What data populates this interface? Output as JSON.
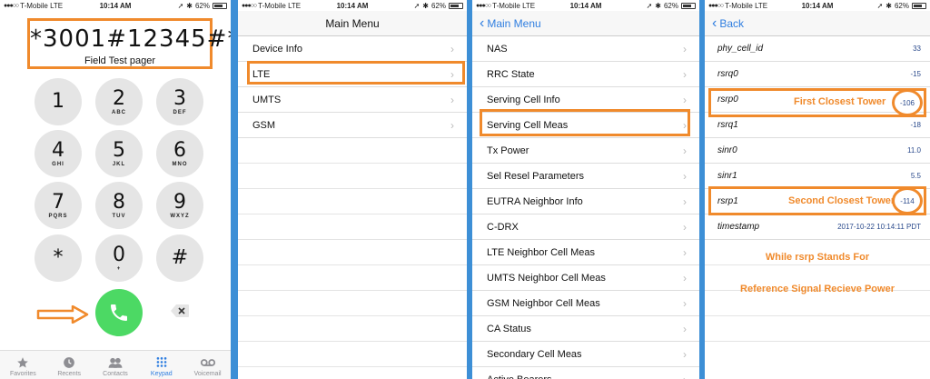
{
  "status": {
    "carrier": "T-Mobile",
    "network": "LTE",
    "time": "10:14 AM",
    "battery": "62%",
    "battery_level": 0.62
  },
  "keypad": {
    "dial_number": "*3001#12345#*",
    "dial_subtitle": "Field Test pager",
    "keys": [
      {
        "digit": "1",
        "letters": ""
      },
      {
        "digit": "2",
        "letters": "ABC"
      },
      {
        "digit": "3",
        "letters": "DEF"
      },
      {
        "digit": "4",
        "letters": "GHI"
      },
      {
        "digit": "5",
        "letters": "JKL"
      },
      {
        "digit": "6",
        "letters": "MNO"
      },
      {
        "digit": "7",
        "letters": "PQRS"
      },
      {
        "digit": "8",
        "letters": "TUV"
      },
      {
        "digit": "9",
        "letters": "WXYZ"
      },
      {
        "digit": "*",
        "letters": ""
      },
      {
        "digit": "0",
        "letters": "+"
      },
      {
        "digit": "#",
        "letters": ""
      }
    ],
    "tabs": [
      {
        "label": "Favorites",
        "icon": "star-icon"
      },
      {
        "label": "Recents",
        "icon": "clock-icon"
      },
      {
        "label": "Contacts",
        "icon": "contacts-icon"
      },
      {
        "label": "Keypad",
        "icon": "keypad-icon",
        "active": true
      },
      {
        "label": "Voicemail",
        "icon": "voicemail-icon"
      }
    ]
  },
  "main_menu": {
    "title": "Main Menu",
    "items": [
      "Device Info",
      "LTE",
      "UMTS",
      "GSM"
    ]
  },
  "lte_menu": {
    "back_label": "Main Menu",
    "items": [
      "NAS",
      "RRC State",
      "Serving Cell Info",
      "Serving Cell Meas",
      "Tx Power",
      "Sel Resel Parameters",
      "EUTRA Neighbor Info",
      "C-DRX",
      "LTE Neighbor Cell Meas",
      "UMTS Neighbor Cell Meas",
      "GSM Neighbor Cell Meas",
      "CA Status",
      "Secondary Cell Meas",
      "Active Bearers"
    ]
  },
  "serving_cell": {
    "back_label": "Back",
    "rows": [
      {
        "key": "phy_cell_id",
        "value": "33"
      },
      {
        "key": "rsrq0",
        "value": "-15"
      },
      {
        "key": "rsrp0",
        "value": "-106"
      },
      {
        "key": "rsrq1",
        "value": "-18"
      },
      {
        "key": "sinr0",
        "value": "11.0"
      },
      {
        "key": "sinr1",
        "value": "5.5"
      },
      {
        "key": "rsrp1",
        "value": "-114"
      },
      {
        "key": "timestamp",
        "value": "2017-10-22 10:14:11 PDT"
      }
    ],
    "annotation_first": "First Closest Tower",
    "annotation_second": "Second Closest Tower",
    "caption_line1": "While rsrp Stands For",
    "caption_line2": "Reference Signal Recieve Power"
  },
  "colors": {
    "highlight": "#f08a2c",
    "ios_blue": "#2f7ee0",
    "call_green": "#4cd964",
    "divider_blue": "#3d8fd6"
  }
}
